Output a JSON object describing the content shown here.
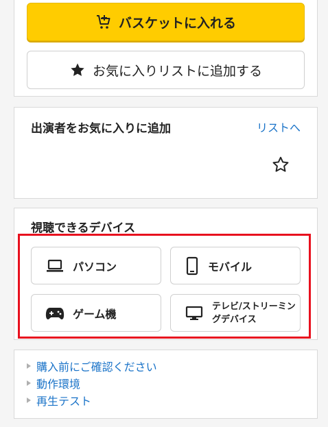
{
  "purchase": {
    "cart_label": "バスケットに入れる",
    "favorite_label": "お気に入りリストに追加する"
  },
  "cast": {
    "title": "出演者をお気に入りに追加",
    "list_link": "リストへ"
  },
  "devices": {
    "title": "視聴できるデバイス",
    "items": [
      {
        "label": "パソコン",
        "icon": "laptop-icon"
      },
      {
        "label": "モバイル",
        "icon": "smartphone-icon"
      },
      {
        "label": "ゲーム機",
        "icon": "gamepad-icon"
      },
      {
        "label": "テレビ/ストリーミングデバイス",
        "icon": "monitor-icon"
      }
    ]
  },
  "links": [
    {
      "label": "購入前にご確認ください"
    },
    {
      "label": "動作環境"
    },
    {
      "label": "再生テスト"
    }
  ],
  "colors": {
    "accent": "#ffcc00",
    "link": "#1a73c8",
    "highlight": "#e8101e"
  }
}
